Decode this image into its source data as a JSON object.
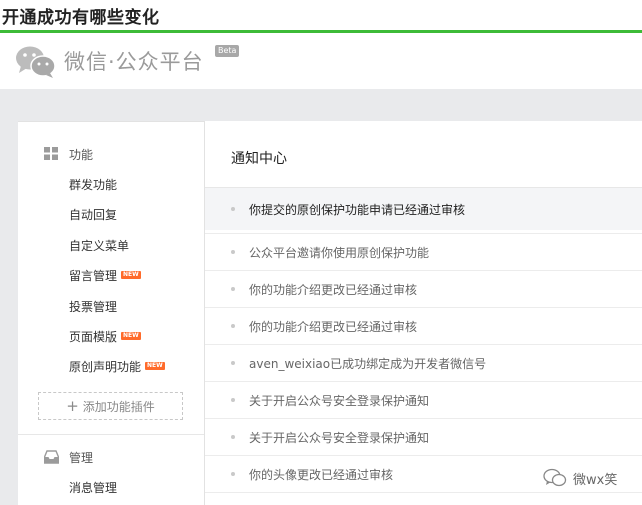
{
  "article": {
    "title": "开通成功有哪些变化"
  },
  "header": {
    "brand": "微信·公众平台",
    "beta": "Beta"
  },
  "sidebar": {
    "function_section": "功能",
    "function_items": [
      {
        "label": "群发功能",
        "new": false
      },
      {
        "label": "自动回复",
        "new": false
      },
      {
        "label": "自定义菜单",
        "new": false
      },
      {
        "label": "留言管理",
        "new": true
      },
      {
        "label": "投票管理",
        "new": false
      },
      {
        "label": "页面模版",
        "new": true
      },
      {
        "label": "原创声明功能",
        "new": true
      }
    ],
    "new_badge": "NEW",
    "add_plugin": "添加功能插件",
    "manage_section": "管理",
    "manage_items": [
      {
        "label": "消息管理"
      }
    ]
  },
  "main": {
    "title": "通知中心",
    "notifications": [
      "你提交的原创保护功能申请已经通过审核",
      "公众平台邀请你使用原创保护功能",
      "你的功能介绍更改已经通过审核",
      "你的功能介绍更改已经通过审核",
      "aven_weixiao已成功绑定成为开发者微信号",
      "关于开启公众号安全登录保护通知",
      "关于开启公众号安全登录保护通知",
      "你的头像更改已经通过审核"
    ]
  },
  "watermark": {
    "text": "微wx笑"
  },
  "icons": {
    "logo": "wechat-logo-icon",
    "function": "grid-icon",
    "manage": "inbox-icon",
    "watermark": "wechat-bubble-icon"
  },
  "colors": {
    "accent": "#3dbb38",
    "new_badge": "#ff6b2b",
    "header_gray": "#e9eaec",
    "highlight_row": "#f4f5f7"
  }
}
